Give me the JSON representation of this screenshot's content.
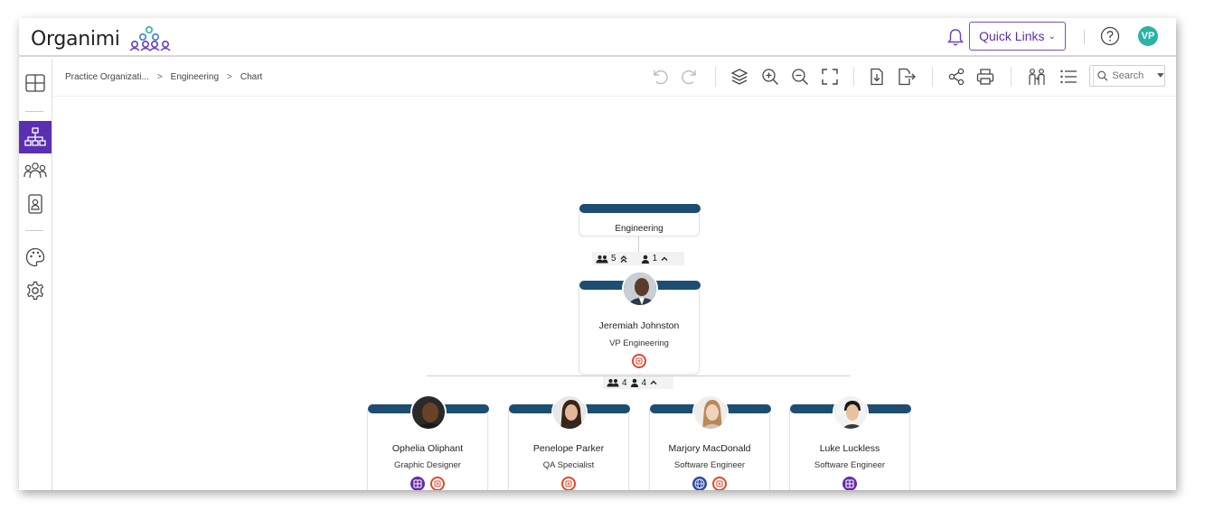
{
  "app": {
    "name": "Organimi"
  },
  "header": {
    "quick_links_label": "Quick Links",
    "quick_links_chevron": "⌄",
    "user_initials": "VP",
    "icons": [
      "bell-icon",
      "help-icon"
    ]
  },
  "sidebar": {
    "items": [
      "dashboard-icon",
      "org-chart-icon",
      "people-icon",
      "directory-icon",
      "theme-icon",
      "settings-icon"
    ],
    "active": "org-chart-icon"
  },
  "breadcrumb": [
    "Practice Organizati...",
    "Engineering",
    "Chart"
  ],
  "breadcrumb_sep": ">",
  "toolbar": {
    "icons": [
      "undo-icon",
      "redo-icon",
      "layers-icon",
      "zoom-in-icon",
      "zoom-out-icon",
      "fit-screen-icon",
      "import-icon",
      "export-icon",
      "share-icon",
      "print-icon",
      "talent-icon",
      "list-view-icon"
    ],
    "search_placeholder": "Search"
  },
  "chart": {
    "department": {
      "name": "Engineering",
      "team_count": "5",
      "direct_count": "1"
    },
    "manager": {
      "name": "Jeremiah Johnston",
      "title": "VP Engineering",
      "team_count": "4",
      "direct_count": "4"
    },
    "reports": [
      {
        "name": "Ophelia Oliphant",
        "title": "Graphic Designer",
        "badges": [
          "purple",
          "red"
        ]
      },
      {
        "name": "Penelope Parker",
        "title": "QA Specialist",
        "badges": [
          "red"
        ]
      },
      {
        "name": "Marjory MacDonald",
        "title": "Software Engineer",
        "badges": [
          "globe",
          "red"
        ]
      },
      {
        "name": "Luke Luckless",
        "title": "Software Engineer",
        "badges": [
          "purple"
        ]
      }
    ]
  },
  "colors": {
    "brand_purple": "#5a2fb0",
    "card_bar": "#1d4e72",
    "badge_red": "#e4472a",
    "badge_purple": "#6a2aa8",
    "avatar_teal": "#2bb3a6"
  }
}
